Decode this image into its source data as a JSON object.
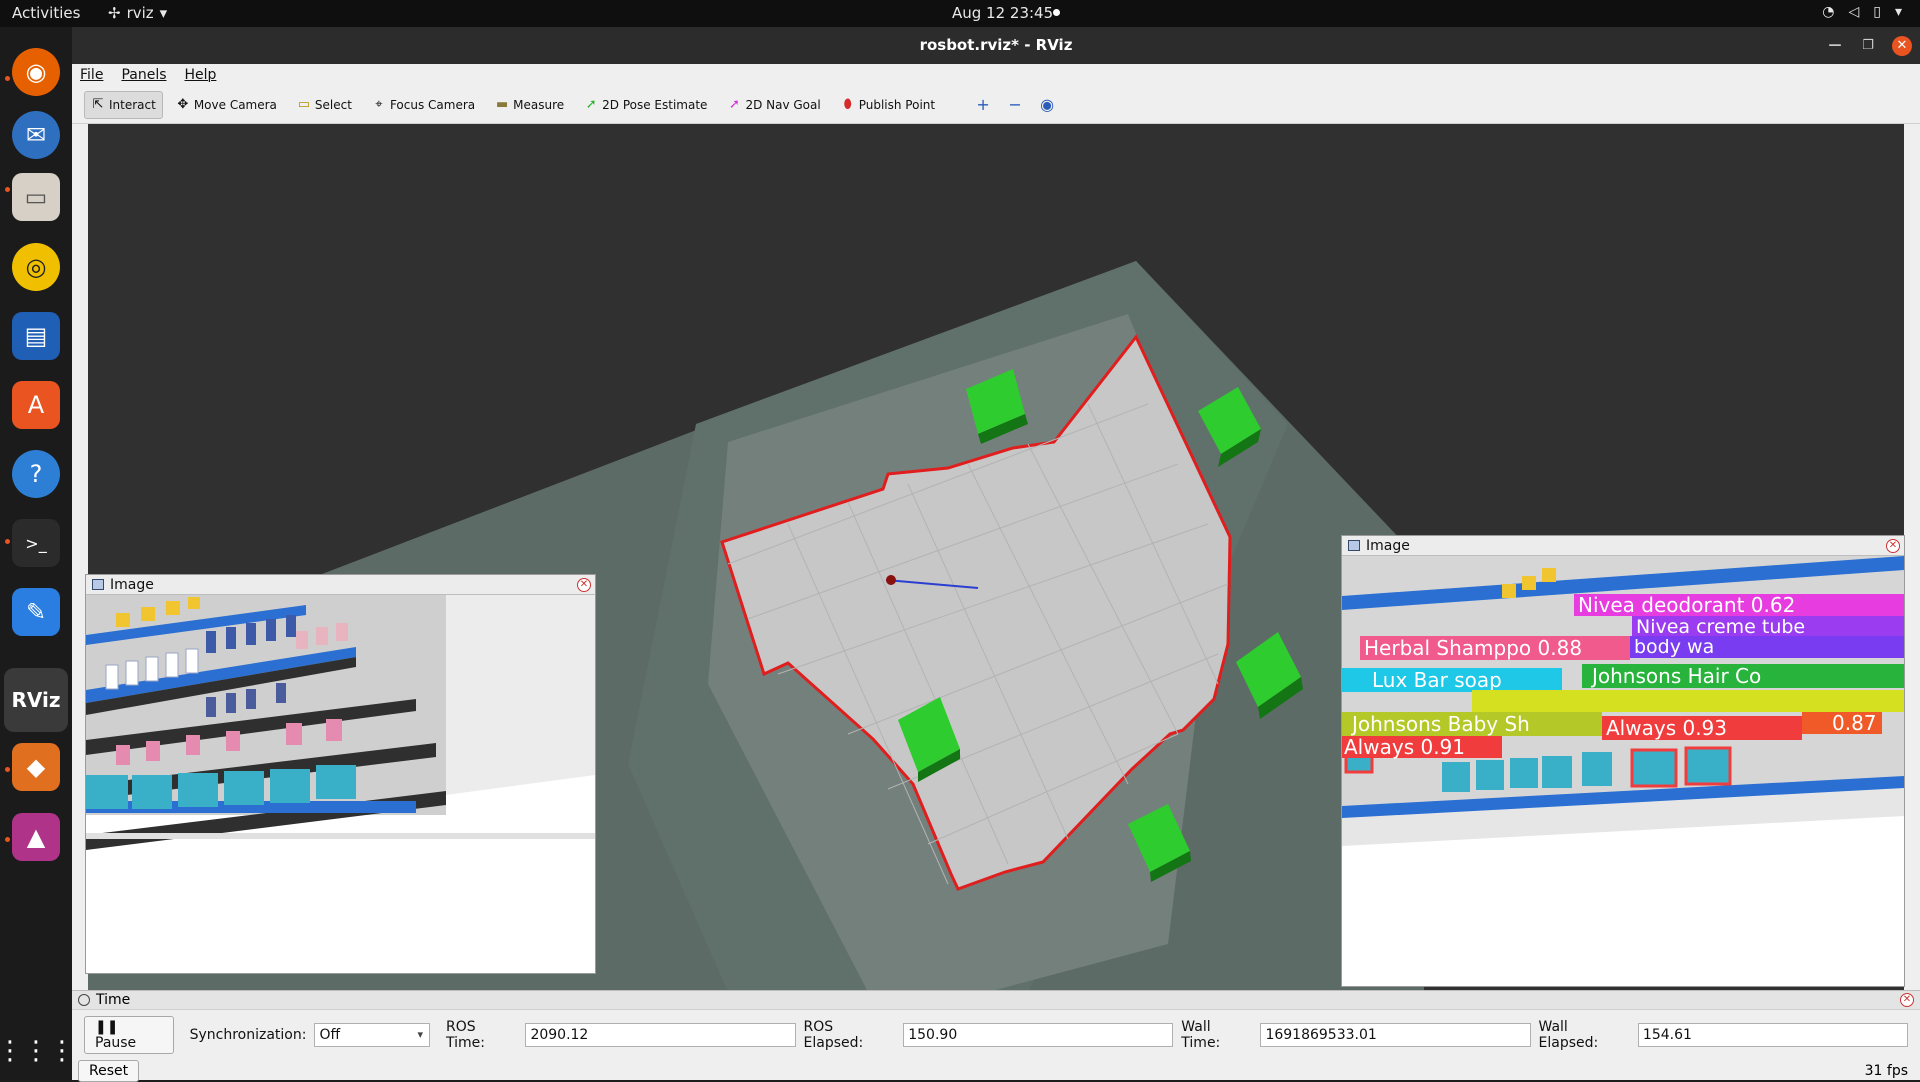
{
  "topbar": {
    "activities": "Activities",
    "app_name": "rviz",
    "clock": "Aug 12  23:45"
  },
  "window": {
    "title": "rosbot.rviz* - RViz"
  },
  "menu": {
    "file": "File",
    "panels": "Panels",
    "help": "Help"
  },
  "toolbar": {
    "tools": [
      {
        "label": "Interact",
        "icon": "cursor-icon"
      },
      {
        "label": "Move Camera",
        "icon": "move-camera-icon"
      },
      {
        "label": "Select",
        "icon": "select-icon"
      },
      {
        "label": "Focus Camera",
        "icon": "focus-camera-icon"
      },
      {
        "label": "Measure",
        "icon": "measure-icon"
      },
      {
        "label": "2D Pose Estimate",
        "icon": "pose-estimate-icon"
      },
      {
        "label": "2D Nav Goal",
        "icon": "nav-goal-icon"
      },
      {
        "label": "Publish Point",
        "icon": "publish-point-icon"
      }
    ]
  },
  "panels": {
    "image_left": {
      "title": "Image"
    },
    "image_right": {
      "title": "Image",
      "detections": [
        {
          "label": "Nivea deodorant 0.62",
          "color": "#e63ce0"
        },
        {
          "label": "Nivea creme tube",
          "color": "#9b3cf0"
        },
        {
          "label": "Herbal Shamppo 0.88",
          "color": "#f05a8c"
        },
        {
          "label": "body wa",
          "color": "#7a3cf0"
        },
        {
          "label": "Lux Bar soap",
          "color": "#1ec8e6"
        },
        {
          "label": "Johnsons Hair Co",
          "color": "#28b43c"
        },
        {
          "label": "Johnsons Baby Sh",
          "color": "#b4c828"
        },
        {
          "label": "Always 0.93",
          "color": "#f03c3c"
        },
        {
          "label": "0.87",
          "color": "#f03c3c"
        },
        {
          "label": "Always 0.91",
          "color": "#f03c3c"
        }
      ]
    }
  },
  "time_panel": {
    "title": "Time",
    "pause_label": "Pause",
    "sync_label": "Synchronization:",
    "sync_value": "Off",
    "ros_time_label": "ROS Time:",
    "ros_time": "2090.12",
    "ros_elapsed_label": "ROS Elapsed:",
    "ros_elapsed": "150.90",
    "wall_time_label": "Wall Time:",
    "wall_time": "1691869533.01",
    "wall_elapsed_label": "Wall Elapsed:",
    "wall_elapsed": "154.61",
    "reset_label": "Reset",
    "fps": "31 fps"
  }
}
